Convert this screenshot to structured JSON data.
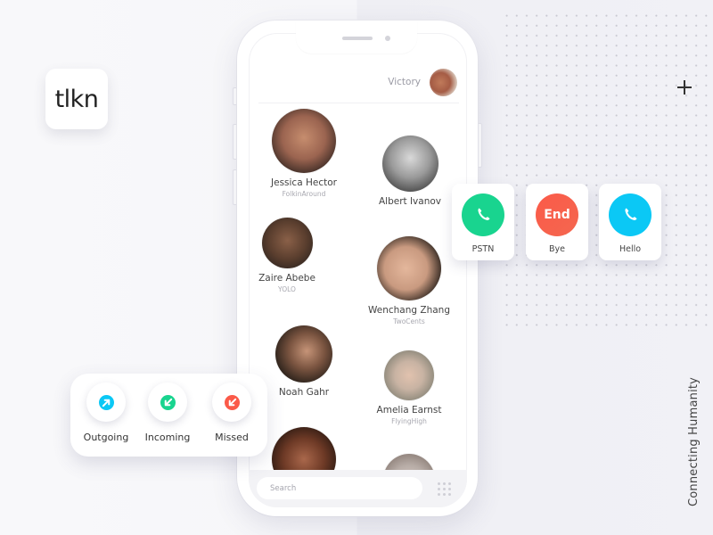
{
  "brand": {
    "logo_text": "tlkn",
    "tagline": "Connecting Humanity"
  },
  "colors": {
    "green": "#19d48f",
    "red": "#fb5a49",
    "blue": "#0bc8f5",
    "text_dark": "#333333",
    "text_muted": "#a8a8b0"
  },
  "header": {
    "user_name": "Victory",
    "avatar_icon": "user-avatar"
  },
  "contacts": [
    {
      "name": "Jessica Hector",
      "handle": "FolkinAround",
      "avatar_color": "#7a5140"
    },
    {
      "name": "Albert Ivanov",
      "handle": "",
      "avatar_color": "#6b6b6b"
    },
    {
      "name": "Zaire Abebe",
      "handle": "YOLO",
      "avatar_color": "#4a3428"
    },
    {
      "name": "Wenchang Zhang",
      "handle": "TwoCents",
      "avatar_color": "#c99a80"
    },
    {
      "name": "Noah Gahr",
      "handle": "",
      "avatar_color": "#3a2a20"
    },
    {
      "name": "Amelia Earnst",
      "handle": "FlyingHigh",
      "avatar_color": "#b6a79a"
    },
    {
      "name": "",
      "handle": "",
      "avatar_color": "#3b2216"
    },
    {
      "name": "",
      "handle": "",
      "avatar_color": "#b7aca6"
    }
  ],
  "search": {
    "placeholder": "Search",
    "value": ""
  },
  "call_actions": [
    {
      "label": "PSTN",
      "icon": "phone-icon",
      "color": "#19d48f",
      "glyph": ""
    },
    {
      "label": "Bye",
      "icon": "end-call-icon",
      "color": "#fb5a49",
      "glyph": "End"
    },
    {
      "label": "Hello",
      "icon": "phone-icon",
      "color": "#0bc8f5",
      "glyph": ""
    }
  ],
  "call_filters": [
    {
      "label": "Outgoing",
      "icon": "outgoing-arrow-icon",
      "color": "#0bc8f5"
    },
    {
      "label": "Incoming",
      "icon": "incoming-arrow-icon",
      "color": "#19d48f"
    },
    {
      "label": "Missed",
      "icon": "missed-arrow-icon",
      "color": "#fb5a49"
    }
  ]
}
